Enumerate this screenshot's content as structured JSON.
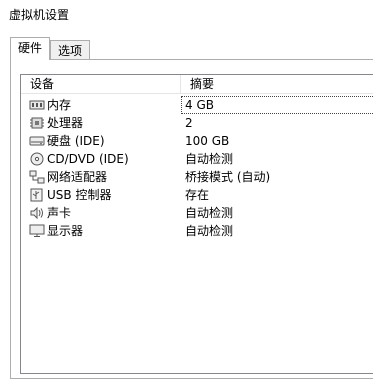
{
  "window": {
    "title": "虚拟机设置"
  },
  "tabs": [
    {
      "label": "硬件",
      "active": true
    },
    {
      "label": "选项",
      "active": false
    }
  ],
  "list": {
    "columns": [
      "设备",
      "摘要"
    ],
    "rows": [
      {
        "device": "内存",
        "summary": "4 GB",
        "icon": "memory-icon",
        "selected": true
      },
      {
        "device": "处理器",
        "summary": "2",
        "icon": "processor-icon"
      },
      {
        "device": "硬盘 (IDE)",
        "summary": "100 GB",
        "icon": "hard-disk-icon"
      },
      {
        "device": "CD/DVD (IDE)",
        "summary": "自动检测",
        "icon": "cd-dvd-icon"
      },
      {
        "device": "网络适配器",
        "summary": "桥接模式 (自动)",
        "icon": "network-adapter-icon"
      },
      {
        "device": "USB 控制器",
        "summary": "存在",
        "icon": "usb-controller-icon"
      },
      {
        "device": "声卡",
        "summary": "自动检测",
        "icon": "sound-card-icon"
      },
      {
        "device": "显示器",
        "summary": "自动检测",
        "icon": "display-icon"
      }
    ]
  }
}
